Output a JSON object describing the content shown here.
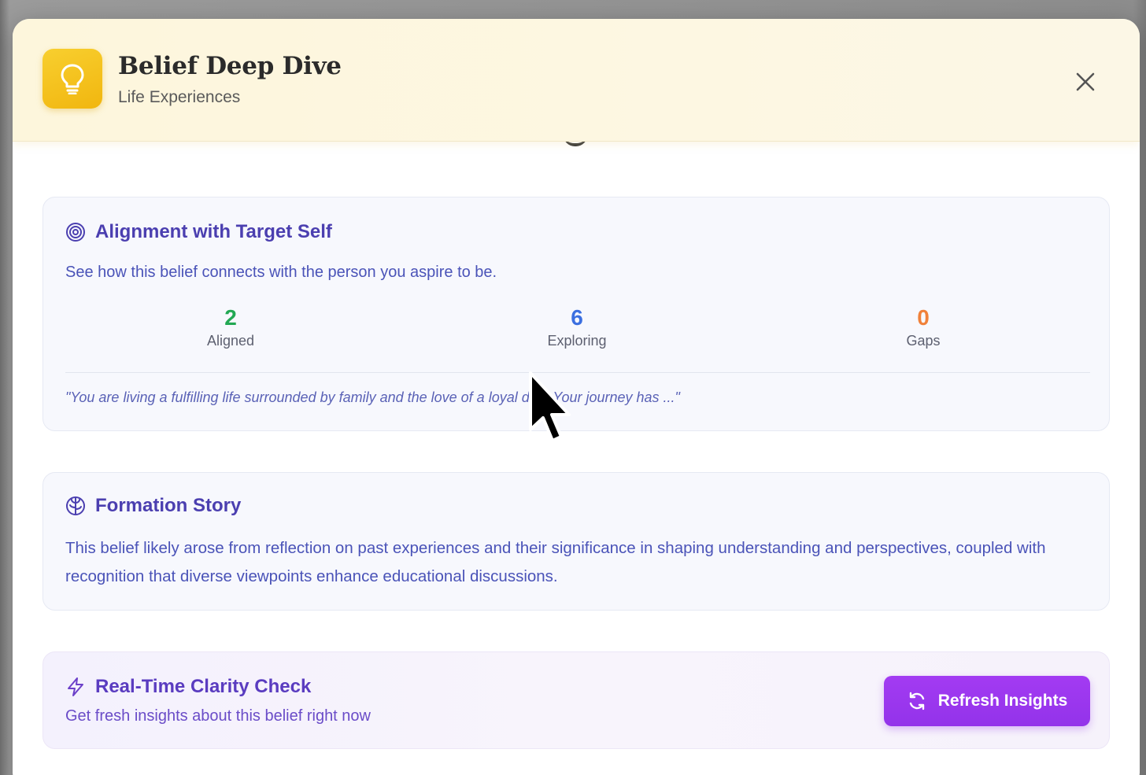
{
  "colors": {
    "accent_purple": "#9333ea",
    "heading_indigo": "#4b3fb0",
    "aligned_green": "#22a853",
    "exploring_blue": "#3b6fe0",
    "gaps_orange": "#f0813a",
    "icon_yellow": "#f5c21c"
  },
  "header": {
    "icon": "lightbulb-icon",
    "title": "Belief Deep Dive",
    "subtitle": "Life Experiences",
    "close_icon": "close-icon"
  },
  "alignment": {
    "icon": "target-icon",
    "title": "Alignment with Target Self",
    "description": "See how this belief connects with the person you aspire to be.",
    "stats": [
      {
        "value": "2",
        "label": "Aligned"
      },
      {
        "value": "6",
        "label": "Exploring"
      },
      {
        "value": "0",
        "label": "Gaps"
      }
    ],
    "quote": "\"You are living a fulfilling life surrounded by family and the love of a loyal dog. Your journey has ...\""
  },
  "formation": {
    "icon": "brain-icon",
    "title": "Formation Story",
    "text": "This belief likely arose from reflection on past experiences and their significance in shaping understanding and perspectives, coupled with recognition that diverse viewpoints enhance educational discussions."
  },
  "clarity": {
    "icon": "lightning-icon",
    "title": "Real-Time Clarity Check",
    "description": "Get fresh insights about this belief right now",
    "button_label": "Refresh Insights",
    "button_icon": "refresh-icon"
  }
}
